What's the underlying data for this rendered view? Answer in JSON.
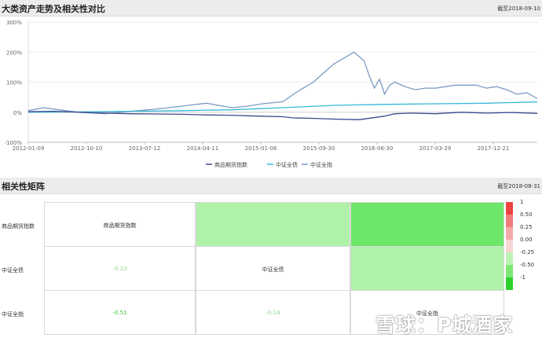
{
  "section1": {
    "title": "大类资产走势及相关性对比",
    "date": "截至2018-09-10"
  },
  "section2": {
    "title": "相关性矩阵",
    "date": "截至2018-08-31"
  },
  "chart_data": {
    "type": "line",
    "yticks": [
      "300%",
      "200%",
      "100%",
      "0%",
      "-100%"
    ],
    "ylim": [
      -100,
      300
    ],
    "xticks": [
      "2012-01-09",
      "2012-10-10",
      "2013-07-12",
      "2014-04-11",
      "2015-01-06",
      "2015-09-30",
      "2016-06-30",
      "2017-03-29",
      "2017-12-21"
    ],
    "legend_position": "bottom",
    "series": [
      {
        "name": "商品期货指数",
        "color": "#3d4a8f",
        "t": [
          0,
          0.05,
          0.1,
          0.15,
          0.2,
          0.25,
          0.3,
          0.35,
          0.4,
          0.45,
          0.5,
          0.52,
          0.55,
          0.6,
          0.65,
          0.7,
          0.72,
          0.75,
          0.8,
          0.85,
          0.9,
          0.95,
          1.0
        ],
        "y": [
          2,
          3,
          0,
          -3,
          -5,
          -6,
          -7,
          -9,
          -10,
          -13,
          -15,
          -19,
          -20,
          -23,
          -25,
          -13,
          -5,
          -3,
          -5,
          0,
          -3,
          -1,
          -4
        ]
      },
      {
        "name": "中证全债",
        "color": "#36b9d9",
        "t": [
          0,
          0.1,
          0.2,
          0.3,
          0.4,
          0.5,
          0.55,
          0.6,
          0.7,
          0.8,
          0.9,
          1.0
        ],
        "y": [
          0,
          1,
          3,
          5,
          8,
          15,
          19,
          23,
          26,
          28,
          30,
          34
        ]
      },
      {
        "name": "中证全指",
        "color": "#7b9bc0",
        "t": [
          0,
          0.03,
          0.06,
          0.1,
          0.15,
          0.2,
          0.25,
          0.3,
          0.35,
          0.4,
          0.43,
          0.46,
          0.5,
          0.53,
          0.56,
          0.58,
          0.6,
          0.62,
          0.64,
          0.66,
          0.67,
          0.68,
          0.69,
          0.7,
          0.71,
          0.72,
          0.74,
          0.76,
          0.78,
          0.8,
          0.82,
          0.84,
          0.86,
          0.88,
          0.9,
          0.92,
          0.94,
          0.96,
          0.98,
          1.0
        ],
        "y": [
          5,
          15,
          8,
          0,
          -5,
          3,
          10,
          20,
          30,
          15,
          20,
          28,
          35,
          70,
          100,
          130,
          160,
          180,
          200,
          170,
          120,
          80,
          110,
          60,
          90,
          100,
          85,
          75,
          80,
          80,
          85,
          90,
          90,
          90,
          80,
          85,
          75,
          60,
          65,
          45
        ]
      }
    ]
  },
  "legend": [
    "商品期货指数",
    "中证全债",
    "中证全指"
  ],
  "matrix": {
    "rows": [
      {
        "label": "商品期货指数",
        "cells": [
          {
            "text": "商品期货指数",
            "color": "#333333",
            "bg": "#ffffff"
          },
          {
            "text": "",
            "bg": "#b0f2a9"
          },
          {
            "text": "",
            "bg": "#6ee66a"
          }
        ]
      },
      {
        "label": "中证全债",
        "cells": [
          {
            "text": "-0.23",
            "color": "#8ed98a",
            "bg": "#ffffff"
          },
          {
            "text": "中证全债",
            "color": "#333333",
            "bg": "#ffffff"
          },
          {
            "text": "",
            "bg": "#b0f2a9"
          }
        ]
      },
      {
        "label": "中证全指",
        "cells": [
          {
            "text": "-0.51",
            "color": "#3cbf3a",
            "bg": "#ffffff"
          },
          {
            "text": "-0.18",
            "color": "#8ed98a",
            "bg": "#ffffff"
          },
          {
            "text": "中证全指",
            "color": "#333333",
            "bg": "#ffffff"
          }
        ]
      }
    ],
    "scale": [
      {
        "label": "1",
        "color": "#ee4444"
      },
      {
        "label": "0.50",
        "color": "#f07c7c"
      },
      {
        "label": "0.25",
        "color": "#f4a9a9"
      },
      {
        "label": "0.00",
        "color": "#f9d6d6"
      },
      {
        "label": "-0.25",
        "color": "#bdf2b5"
      },
      {
        "label": "-0.50",
        "color": "#7ae873"
      },
      {
        "label": "-1",
        "color": "#2ed12a"
      }
    ]
  },
  "watermark": "雪球：P城酒家"
}
